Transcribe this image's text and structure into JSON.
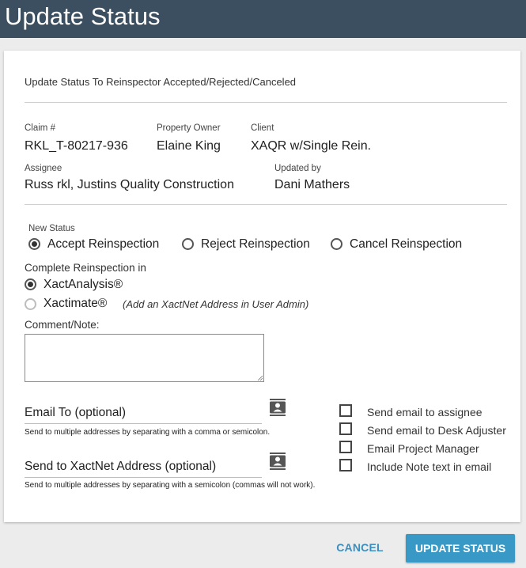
{
  "header": {
    "title": "Update Status"
  },
  "form": {
    "subtitle": "Update Status To Reinspector Accepted/Rejected/Canceled",
    "claim": {
      "label": "Claim #",
      "value": "RKL_T-80217-936"
    },
    "property_owner": {
      "label": "Property Owner",
      "value": "Elaine King"
    },
    "client": {
      "label": "Client",
      "value": "XAQR w/Single Rein."
    },
    "assignee": {
      "label": "Assignee",
      "value": "Russ rkl, Justins Quality Construction"
    },
    "updated_by": {
      "label": "Updated by",
      "value": "Dani Mathers"
    },
    "new_status": {
      "label": "New Status",
      "options": [
        "Accept Reinspection",
        "Reject Reinspection",
        "Cancel Reinspection"
      ],
      "selected": "Accept Reinspection"
    },
    "complete_in": {
      "label": "Complete Reinspection in",
      "options": [
        "XactAnalysis®",
        "Xactimate®"
      ],
      "selected": "XactAnalysis®",
      "hint": "(Add an XactNet Address in User Admin)"
    },
    "comment": {
      "label": "Comment/Note:",
      "value": ""
    },
    "email_to": {
      "label": "Email To (optional)",
      "help": "Send to multiple addresses by separating with a comma or semicolon."
    },
    "xactnet": {
      "label": "Send to XactNet Address (optional)",
      "help": "Send to multiple addresses by separating with a semicolon (commas will not work)."
    },
    "checkboxes": [
      {
        "label": "Send email to assignee",
        "checked": false
      },
      {
        "label": "Send email to Desk Adjuster",
        "checked": false
      },
      {
        "label": "Email Project Manager",
        "checked": false
      },
      {
        "label": "Include Note text in email",
        "checked": false
      }
    ]
  },
  "actions": {
    "cancel": "CANCEL",
    "update": "UPDATE STATUS"
  },
  "colors": {
    "header_bg": "#3b4f60",
    "accent": "#3899c6"
  }
}
